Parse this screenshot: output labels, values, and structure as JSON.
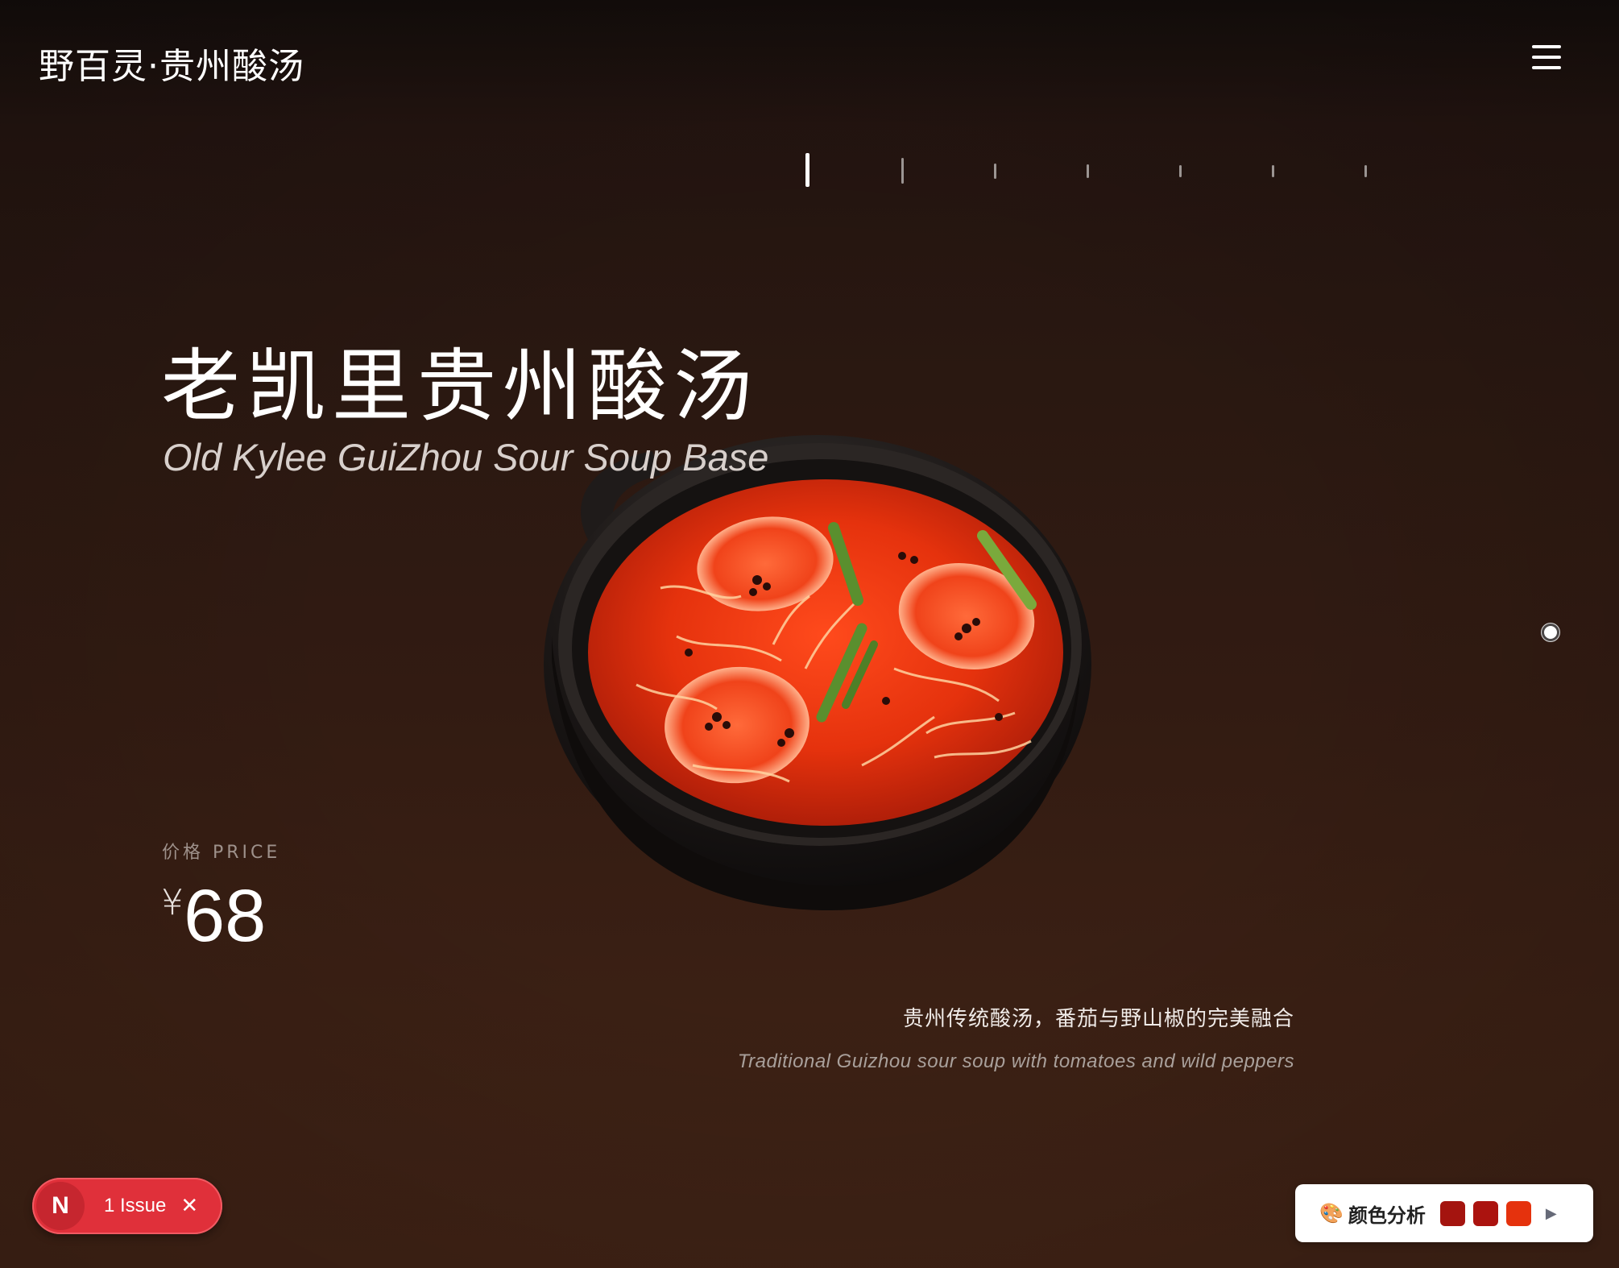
{
  "header": {
    "brand": "野百灵·贵州酸汤",
    "menu_icon": "hamburger-menu-icon"
  },
  "slides": {
    "count": 7,
    "active_index": 0
  },
  "dish": {
    "title_cn": "老凯里贵州酸汤",
    "title_en": "Old Kylee GuiZhou Sour Soup Base",
    "price_label": "价格 PRICE",
    "currency": "¥",
    "price": "68",
    "description_cn": "贵州传统酸汤，番茄与野山椒的完美融合",
    "description_en": "Traditional Guizhou sour soup with tomatoes and wild peppers"
  },
  "issue_badge": {
    "logo": "N",
    "label": "1 Issue",
    "close": "✕"
  },
  "color_widget": {
    "icon": "🎨",
    "title": "颜色分析",
    "swatches": [
      "#a4140f",
      "#ab130f",
      "#e5320d"
    ],
    "play": "▶"
  },
  "colors": {
    "soup_red": "#e5320d",
    "pot_black": "#1b1716",
    "issue_red": "#e0303a"
  }
}
